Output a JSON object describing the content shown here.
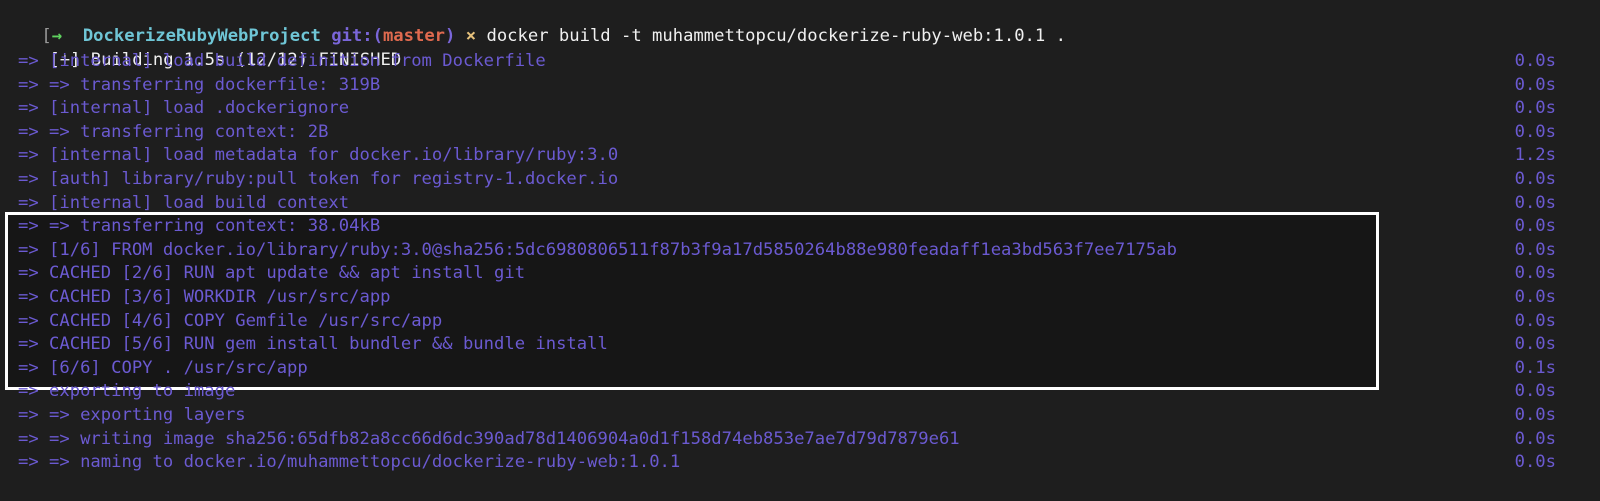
{
  "terminal": {
    "prompt": {
      "bracket": "[",
      "arrow": "→",
      "directory": "DockerizeRubyWebProject",
      "git_label": "git:(",
      "git_branch": "master",
      "git_close": ")",
      "dirty_marker": "×",
      "command": "docker build -t muhammettopcu/dockerize-ruby-web:1.0.1 ."
    },
    "build_status": "[+] Building 1.5s (12/12) FINISHED",
    "steps": [
      {
        "text": "=> [internal] load build definition from Dockerfile",
        "time": "0.0s"
      },
      {
        "text": "=> => transferring dockerfile: 319B",
        "time": "0.0s"
      },
      {
        "text": "=> [internal] load .dockerignore",
        "time": "0.0s"
      },
      {
        "text": "=> => transferring context: 2B",
        "time": "0.0s"
      },
      {
        "text": "=> [internal] load metadata for docker.io/library/ruby:3.0",
        "time": "1.2s"
      },
      {
        "text": "=> [auth] library/ruby:pull token for registry-1.docker.io",
        "time": "0.0s"
      },
      {
        "text": "=> [internal] load build context",
        "time": "0.0s"
      },
      {
        "text": "=> => transferring context: 38.04kB",
        "time": "0.0s"
      },
      {
        "text": "=> [1/6] FROM docker.io/library/ruby:3.0@sha256:5dc6980806511f87b3f9a17d5850264b88e980feadaff1ea3bd563f7ee7175ab",
        "time": "0.0s"
      },
      {
        "text": "=> CACHED [2/6] RUN apt update && apt install git",
        "time": "0.0s"
      },
      {
        "text": "=> CACHED [3/6] WORKDIR /usr/src/app",
        "time": "0.0s"
      },
      {
        "text": "=> CACHED [4/6] COPY Gemfile /usr/src/app",
        "time": "0.0s"
      },
      {
        "text": "=> CACHED [5/6] RUN gem install bundler && bundle install",
        "time": "0.0s"
      },
      {
        "text": "=> [6/6] COPY . /usr/src/app",
        "time": "0.1s"
      },
      {
        "text": "=> exporting to image",
        "time": "0.0s"
      },
      {
        "text": "=> => exporting layers",
        "time": "0.0s"
      },
      {
        "text": "=> => writing image sha256:65dfb82a8cc66d6dc390ad78d1406904a0d1f158d74eb853e7ae7d79d7879e61",
        "time": "0.0s"
      },
      {
        "text": "=> => naming to docker.io/muhammettopcu/dockerize-ruby-web:1.0.1",
        "time": "0.0s"
      }
    ],
    "highlight_box_covers_steps": [
      7,
      13
    ],
    "colors": {
      "background": "#1e1e1e",
      "step_text": "#6b5ad1",
      "directory": "#6fc6d6",
      "git_branch": "#e06a4f",
      "highlight_border": "#ffffff"
    }
  }
}
